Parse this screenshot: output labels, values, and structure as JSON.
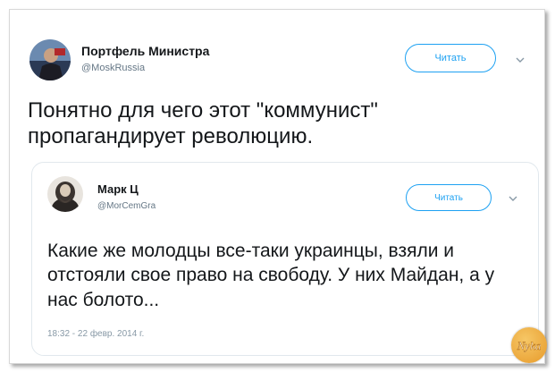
{
  "tweet": {
    "author_name": "Портфель Министра",
    "author_handle": "@MoskRussia",
    "follow_label": "Читать",
    "text": "Понятно для чего этот \"коммунист\" пропагандирует революцию."
  },
  "quoted_tweet": {
    "author_name": "Марк Ц",
    "author_handle": "@MorCemGra",
    "follow_label": "Читать",
    "text": "Какие же молодцы все-таки украинцы, взяли и отстояли свое право на свободу. У них Майдан, а у нас болото...",
    "timestamp": "18:32 - 22 февр. 2014 г."
  },
  "watermark": {
    "text": "Nyka"
  },
  "colors": {
    "accent": "#1da1f2",
    "text": "#14171a",
    "muted": "#657786"
  }
}
